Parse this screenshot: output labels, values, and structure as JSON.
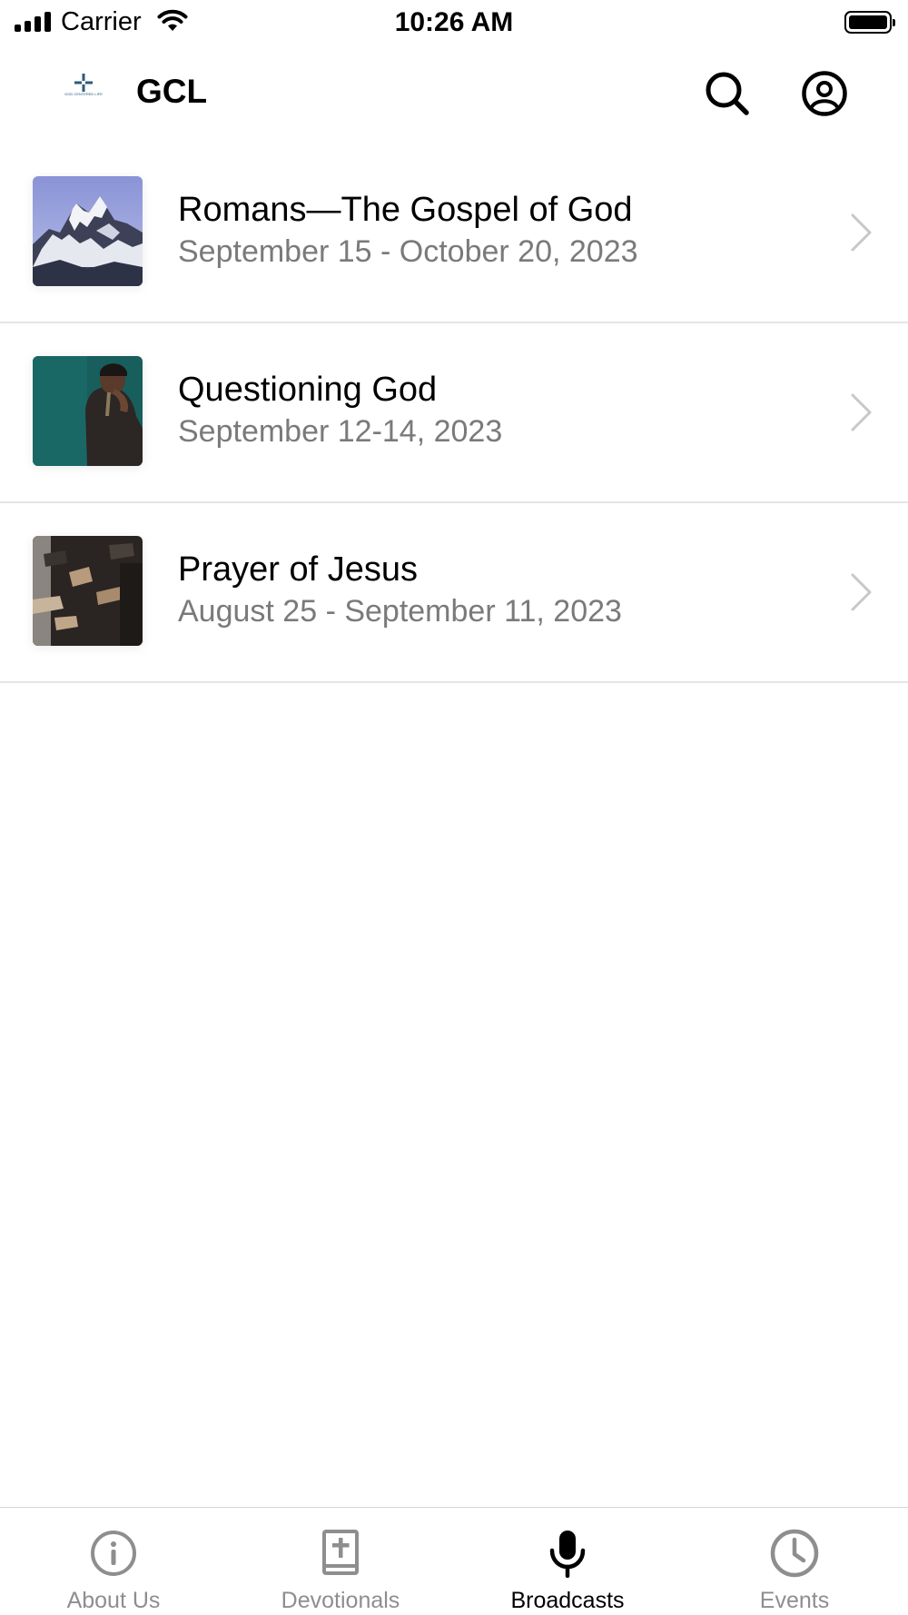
{
  "status_bar": {
    "carrier": "Carrier",
    "time": "10:26 AM",
    "signal_icon": "cellular-signal-icon",
    "wifi_icon": "wifi-icon",
    "battery_icon": "battery-icon"
  },
  "header": {
    "title": "GCL",
    "logo_text": "GOD CENTERED LIFE",
    "search_icon": "search-icon",
    "profile_icon": "user-circle-icon"
  },
  "broadcasts": [
    {
      "title": "Romans—The Gospel of God",
      "date": "September 15 - October 20, 2023",
      "thumbnail": "mountain-photo"
    },
    {
      "title": "Questioning God",
      "date": "September 12-14, 2023",
      "thumbnail": "man-thinking-photo"
    },
    {
      "title": "Prayer of Jesus",
      "date": "August 25 - September 11, 2023",
      "thumbnail": "praying-hands-photo"
    }
  ],
  "tabs": [
    {
      "label": "About Us",
      "icon": "info-icon",
      "active": false
    },
    {
      "label": "Devotionals",
      "icon": "bible-icon",
      "active": false
    },
    {
      "label": "Broadcasts",
      "icon": "microphone-icon",
      "active": true
    },
    {
      "label": "Events",
      "icon": "clock-icon",
      "active": false
    }
  ],
  "colors": {
    "inactive_tab": "#8e8e8e",
    "active_tab": "#000000",
    "subtitle": "#7a7a7a",
    "divider": "#e5e5e5",
    "logo_blue": "#2d5a7a"
  }
}
